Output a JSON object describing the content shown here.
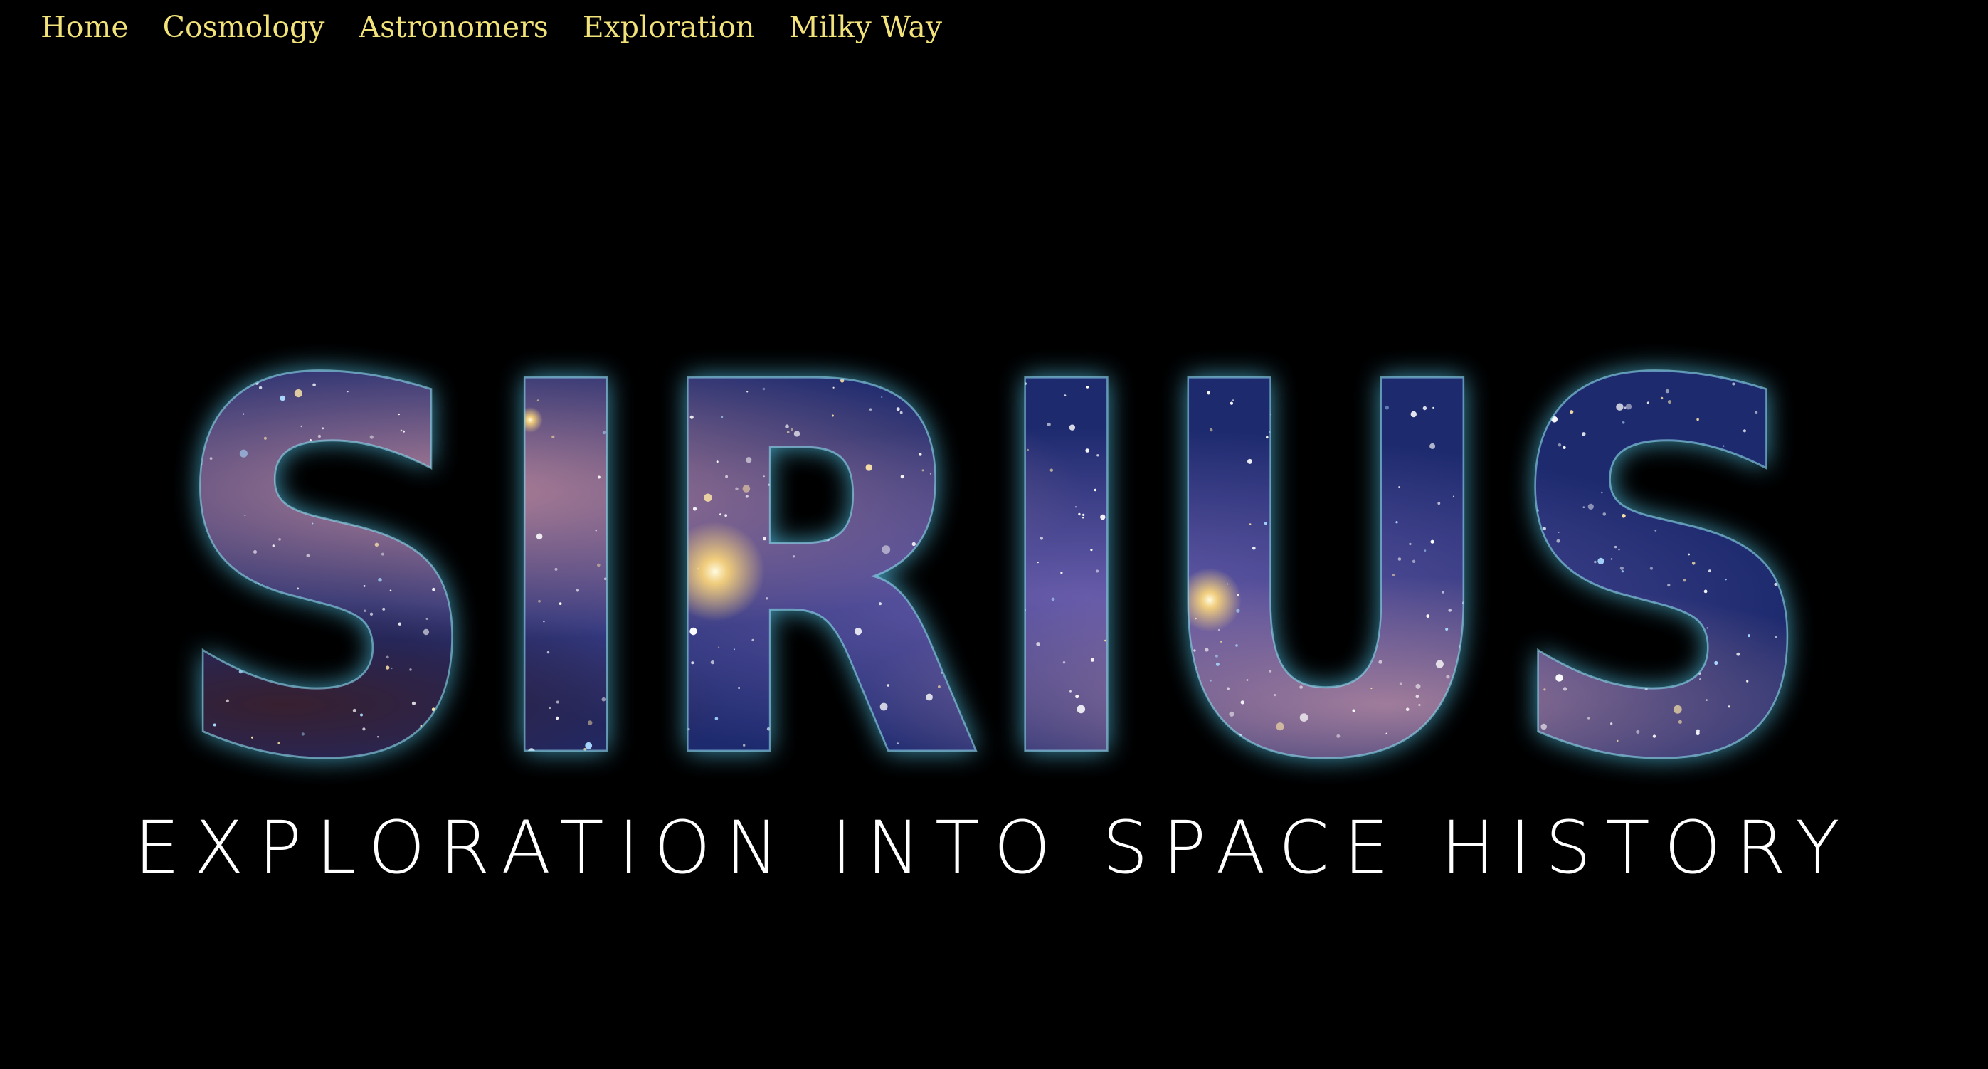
{
  "nav": {
    "items": [
      {
        "label": "Home"
      },
      {
        "label": "Cosmology"
      },
      {
        "label": "Astronomers"
      },
      {
        "label": "Exploration"
      },
      {
        "label": "Milky Way"
      }
    ],
    "link_color": "#f2e27a"
  },
  "hero": {
    "logo_text": "SIRIUS",
    "tagline": "EXPLORATION INTO SPACE HISTORY",
    "glow_color": "#4fb6d8",
    "nebula_colors": [
      "#2a3a8a",
      "#5b4a9a",
      "#c88a9a",
      "#1a2a6a"
    ]
  },
  "colors": {
    "background": "#000000",
    "tagline": "#ffffff"
  }
}
